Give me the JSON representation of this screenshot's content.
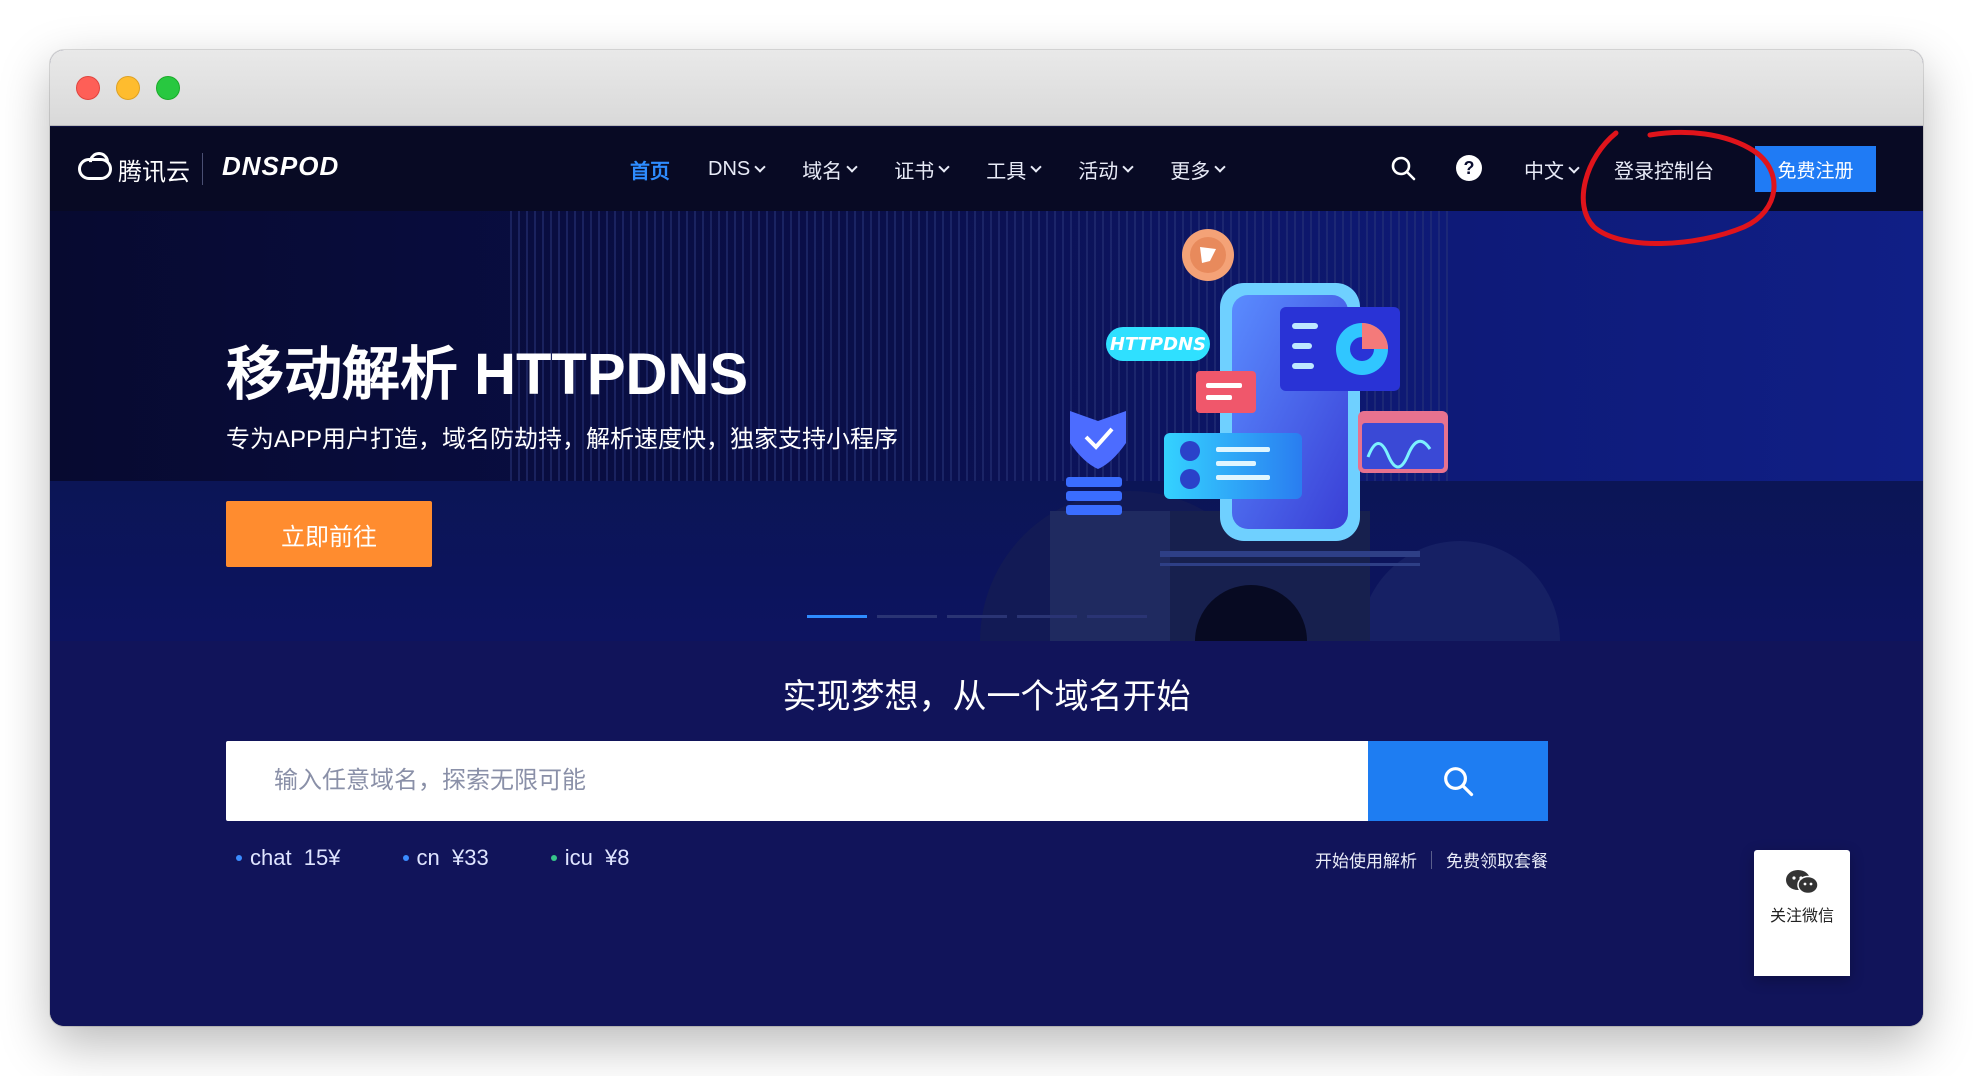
{
  "header": {
    "brand_tencent": "腾讯云",
    "brand_dnspod": "DNSPOD",
    "nav": [
      {
        "label": "首页",
        "active": true
      },
      {
        "label": "DNS"
      },
      {
        "label": "域名"
      },
      {
        "label": "证书"
      },
      {
        "label": "工具"
      },
      {
        "label": "活动"
      },
      {
        "label": "更多"
      }
    ],
    "help_glyph": "?",
    "language": "中文",
    "login": "登录控制台",
    "register": "免费注册"
  },
  "hero": {
    "title": "移动解析 HTTPDNS",
    "subtitle": "专为APP用户打造，域名防劫持，解析速度快，独家支持小程序",
    "cta": "立即前往",
    "badge": "HTTPDNS",
    "slides": 5,
    "active_slide": 1
  },
  "domain": {
    "title": "实现梦想，从一个域名开始",
    "placeholder": "输入任意域名，探索无限可能",
    "tlds": [
      {
        "label": "chat  15¥"
      },
      {
        "label": "cn  ¥33"
      },
      {
        "label": "icu  ¥8"
      }
    ],
    "link_start": "开始使用解析",
    "link_free": "免费领取套餐"
  },
  "floating": {
    "wechat": "关注微信"
  },
  "colors": {
    "accent": "#1f7bf5",
    "cta": "#ff8c2f",
    "annotation": "#e0141b"
  }
}
